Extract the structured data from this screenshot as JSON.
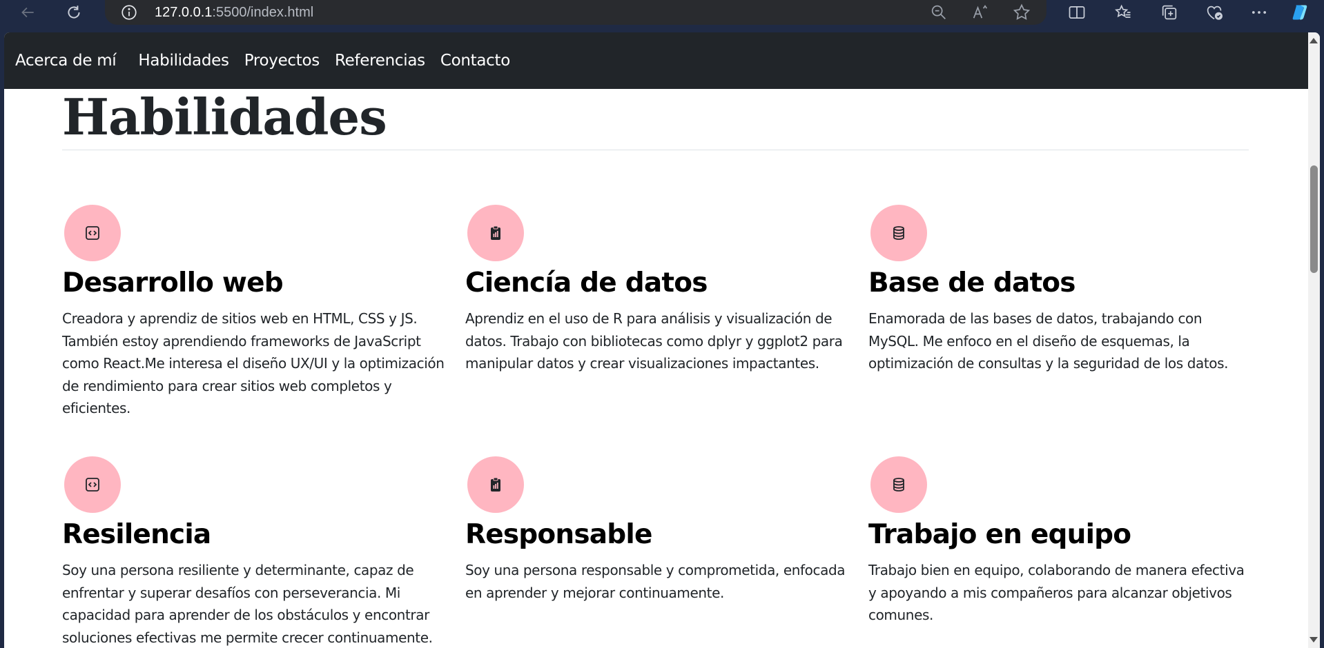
{
  "browser": {
    "url_host": "127.0.0.1",
    "url_rest": ":5500/index.html",
    "icons": [
      "back-icon",
      "reload-icon",
      "info-icon",
      "zoom-out-icon",
      "read-aloud-icon",
      "favorite-star-icon",
      "split-screen-icon",
      "favorites-icon",
      "collections-icon",
      "browser-essentials-icon",
      "more-icon",
      "copilot-icon"
    ]
  },
  "nav": {
    "links": [
      "Acerca de mí",
      "Habilidades",
      "Proyectos",
      "Referencias",
      "Contacto"
    ]
  },
  "section": {
    "title": "Habilidades"
  },
  "features": [
    {
      "icon": "code-icon",
      "title": "Desarrollo web",
      "text": "Creadora y aprendiz de sitios web en HTML, CSS y JS. También estoy aprendiendo frameworks de JavaScript como React.Me interesa el diseño UX/UI y la optimización de rendimiento para crear sitios web completos y eficientes."
    },
    {
      "icon": "clipboard-chart-icon",
      "title": "Ciencía de datos",
      "text": "Aprendiz en el uso de R para análisis y visualización de datos. Trabajo con bibliotecas como dplyr y ggplot2 para manipular datos y crear visualizaciones impactantes."
    },
    {
      "icon": "database-icon",
      "title": "Base de datos",
      "text": "Enamorada de las bases de datos, trabajando con MySQL. Me enfoco en el diseño de esquemas, la optimización de consultas y la seguridad de los datos."
    },
    {
      "icon": "code-icon",
      "title": "Resilencia",
      "text": "Soy una persona resiliente y determinante, capaz de enfrentar y superar desafíos con perseverancia. Mi capacidad para aprender de los obstáculos y encontrar soluciones efectivas me permite crecer continuamente."
    },
    {
      "icon": "clipboard-chart-icon",
      "title": "Responsable",
      "text": "Soy una persona responsable y comprometida, enfocada en aprender y mejorar continuamente."
    },
    {
      "icon": "database-icon",
      "title": "Trabajo en equipo",
      "text": "Trabajo bien en equipo, colaborando de manera efectiva y apoyando a mis compañeros para alcanzar objetivos comunes."
    }
  ],
  "colors": {
    "navbar": "#212529",
    "icon_circle": "#ffb6c1",
    "chrome": "#1f2a44"
  }
}
